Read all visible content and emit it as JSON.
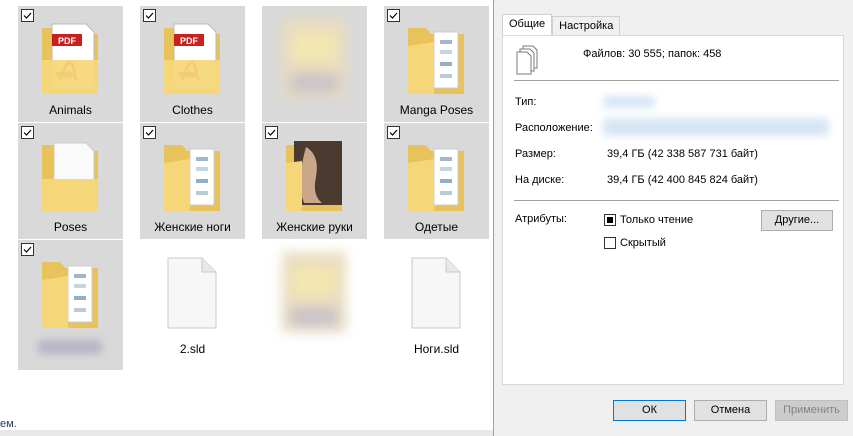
{
  "explorer": {
    "tiles": [
      {
        "label": "Animals",
        "icon": "folder-pdf-icon",
        "selected": true,
        "checked": true
      },
      {
        "label": "Clothes",
        "icon": "folder-pdf-icon",
        "selected": true,
        "checked": true
      },
      {
        "label": "",
        "icon": "blurred-thumbnail",
        "selected": true,
        "checked": false
      },
      {
        "label": "Manga Poses",
        "icon": "folder-images-icon",
        "selected": true,
        "checked": true
      },
      {
        "label": "Poses",
        "icon": "folder-doc-icon",
        "selected": true,
        "checked": true
      },
      {
        "label": "Женские ноги",
        "icon": "folder-images-icon",
        "selected": true,
        "checked": true
      },
      {
        "label": "Женские руки",
        "icon": "folder-photo-icon",
        "selected": true,
        "checked": true
      },
      {
        "label": "Одетые",
        "icon": "folder-images-icon",
        "selected": true,
        "checked": true
      },
      {
        "label": "",
        "icon": "folder-images-icon",
        "selected": true,
        "checked": true
      },
      {
        "label": "2.sld",
        "icon": "file-icon",
        "selected": false,
        "checked": false
      },
      {
        "label": "",
        "icon": "blurred-thumbnail",
        "selected": false,
        "checked": false
      },
      {
        "label": "Ноги.sld",
        "icon": "file-icon",
        "selected": false,
        "checked": false
      }
    ],
    "status_text": "ем."
  },
  "dialog": {
    "tabs": [
      "Общие",
      "Настройка"
    ],
    "summary": "Файлов: 30 555; папок: 458",
    "type_label": "Тип:",
    "location_label": "Расположение:",
    "size_label": "Размер:",
    "size_value": "39,4 ГБ (42 338 587 731 байт)",
    "disk_label": "На диске:",
    "disk_value": "39,4 ГБ (42 400 845 824 байт)",
    "attributes_label": "Атрибуты:",
    "readonly_label": "Только чтение",
    "hidden_label": "Скрытый",
    "other_button": "Другие...",
    "ok_button": "ОК",
    "cancel_button": "Отмена",
    "apply_button": "Применить"
  },
  "colors": {
    "folder": "#f5d77a",
    "folder_dark": "#e8c25a",
    "selection": "#d9d9d9",
    "accent": "#0078d7"
  }
}
